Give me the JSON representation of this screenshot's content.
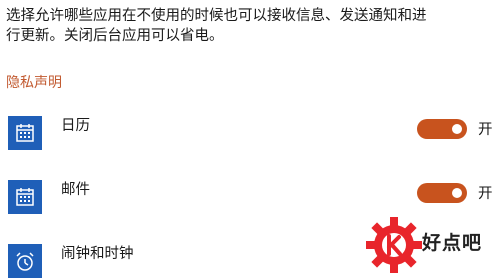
{
  "description": {
    "line1": "选择允许哪些应用在不使用的时候也可以接收信息、发送通知和进",
    "line2": "行更新。关闭后台应用可以省电。"
  },
  "privacy_link": "隐私声明",
  "apps": [
    {
      "name": "日历",
      "icon": "calendar-icon",
      "toggle_on": true,
      "toggle_label": "开"
    },
    {
      "name": "邮件",
      "icon": "calendar-icon",
      "toggle_on": true,
      "toggle_label": "开"
    },
    {
      "name": "闹钟和时钟",
      "icon": "alarm-clock-icon"
    }
  ],
  "watermark": {
    "text": "好点吧"
  },
  "colors": {
    "accent": "#c8531e",
    "tile": "#1f5fb8",
    "link": "#c25a30",
    "watermark_red": "#e8252b"
  }
}
